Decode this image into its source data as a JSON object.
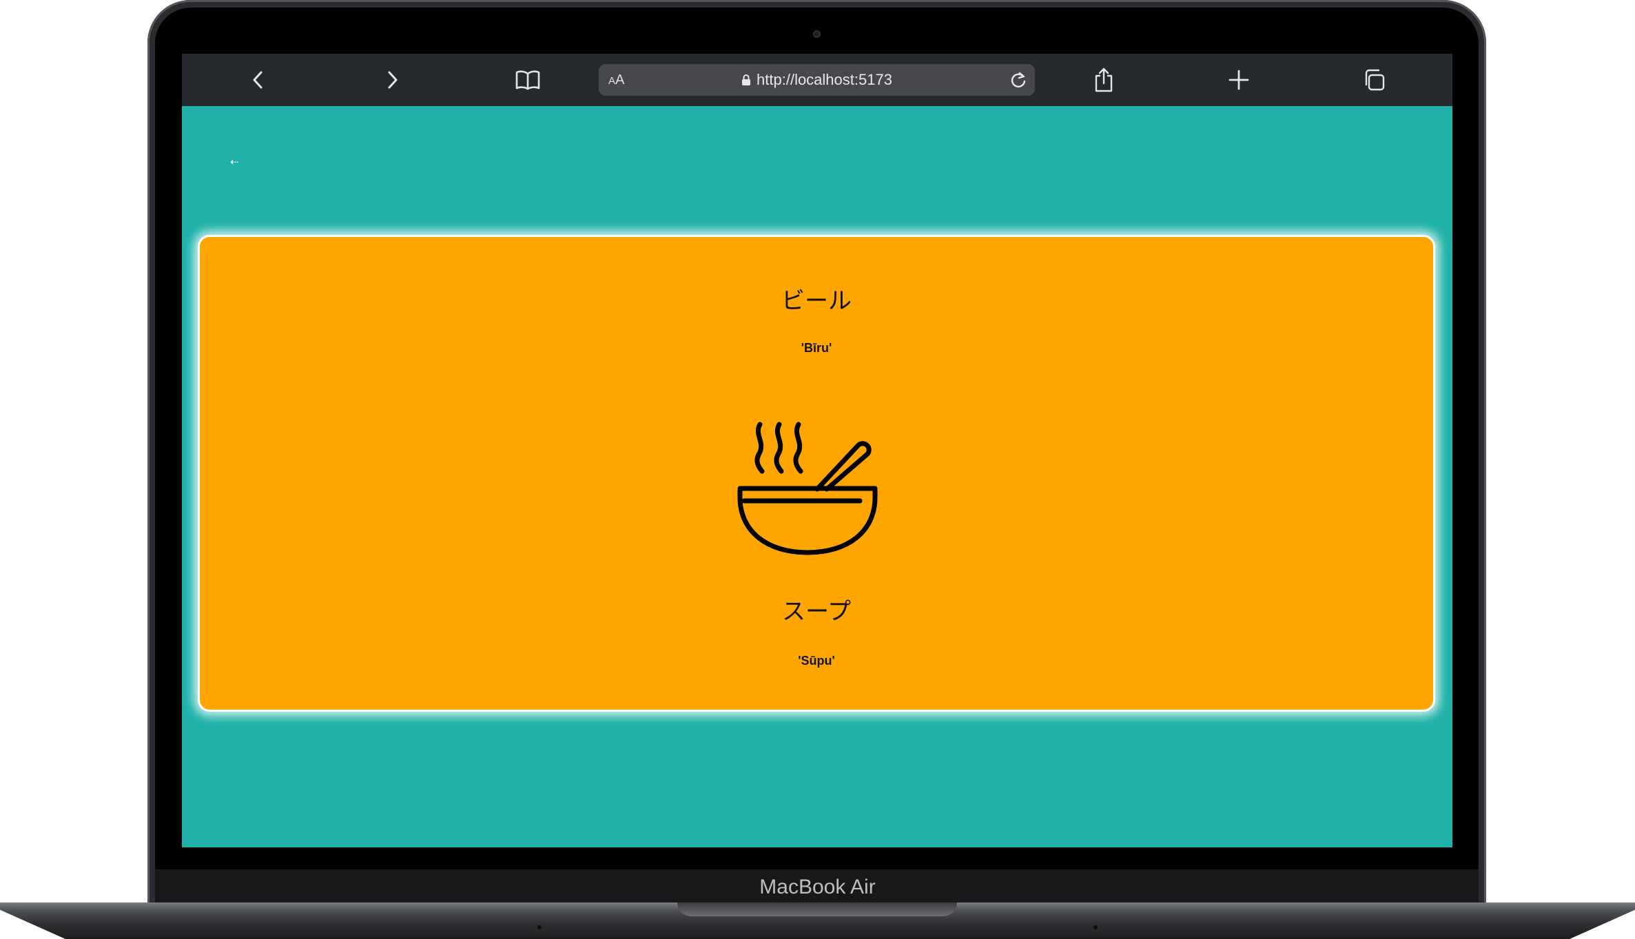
{
  "device": {
    "model_label": "MacBook Air"
  },
  "browser": {
    "text_size_label": "AA",
    "url": "http://localhost:5173",
    "icons": [
      "chevron-left-icon",
      "chevron-right-icon",
      "book-icon",
      "lock-icon",
      "reload-icon",
      "share-icon",
      "plus-icon",
      "tabs-icon"
    ]
  },
  "page": {
    "back_link": "⇠",
    "background_color": "#20b2aa",
    "card": {
      "background_color": "#ffa500",
      "word_1": "ビール",
      "romaji_1": "'Bīru'",
      "icon": "soup-bowl-icon",
      "word_2": "スープ",
      "romaji_2": "'Sūpu'"
    }
  }
}
